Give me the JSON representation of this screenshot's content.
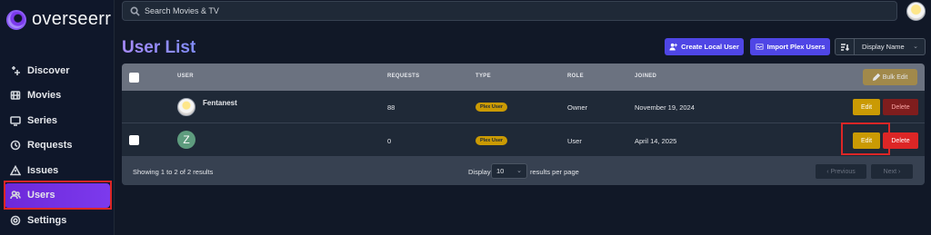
{
  "app": {
    "name": "overseerr"
  },
  "search": {
    "placeholder": "Search Movies & TV"
  },
  "sidebar": {
    "items": [
      {
        "label": "Discover",
        "icon": "sparkles-icon"
      },
      {
        "label": "Movies",
        "icon": "film-icon"
      },
      {
        "label": "Series",
        "icon": "tv-icon"
      },
      {
        "label": "Requests",
        "icon": "clock-icon"
      },
      {
        "label": "Issues",
        "icon": "warning-icon"
      },
      {
        "label": "Users",
        "icon": "users-icon",
        "active": true
      },
      {
        "label": "Settings",
        "icon": "gear-icon"
      }
    ]
  },
  "header": {
    "title": "User List",
    "create_label": "Create Local User",
    "import_label": "Import Plex Users",
    "sort_value": "Display Name"
  },
  "table": {
    "columns": [
      "USER",
      "REQUESTS",
      "TYPE",
      "ROLE",
      "JOINED"
    ],
    "bulk_edit_label": "Bulk Edit",
    "rows": [
      {
        "name": "Fentanest",
        "avatar": "anime-avatar",
        "requests": "88",
        "type": "Plex User",
        "role": "Owner",
        "joined": "November 19, 2024",
        "edit": "Edit",
        "delete": "Delete"
      },
      {
        "name": "",
        "avatar_initial": "Z",
        "requests": "0",
        "type": "Plex User",
        "role": "User",
        "joined": "April 14, 2025",
        "edit": "Edit",
        "delete": "Delete"
      }
    ]
  },
  "pagination": {
    "summary": "Showing 1 to 2 of 2 results",
    "display_label": "Display",
    "per_page": "10",
    "per_page_suffix": "results per page",
    "previous": "Previous",
    "next": "Next"
  },
  "colors": {
    "accent": "#7c3aed",
    "button": "#4f46e5",
    "badge": "#ca9a04",
    "danger": "#dc2626",
    "highlight": "#dc2626"
  }
}
